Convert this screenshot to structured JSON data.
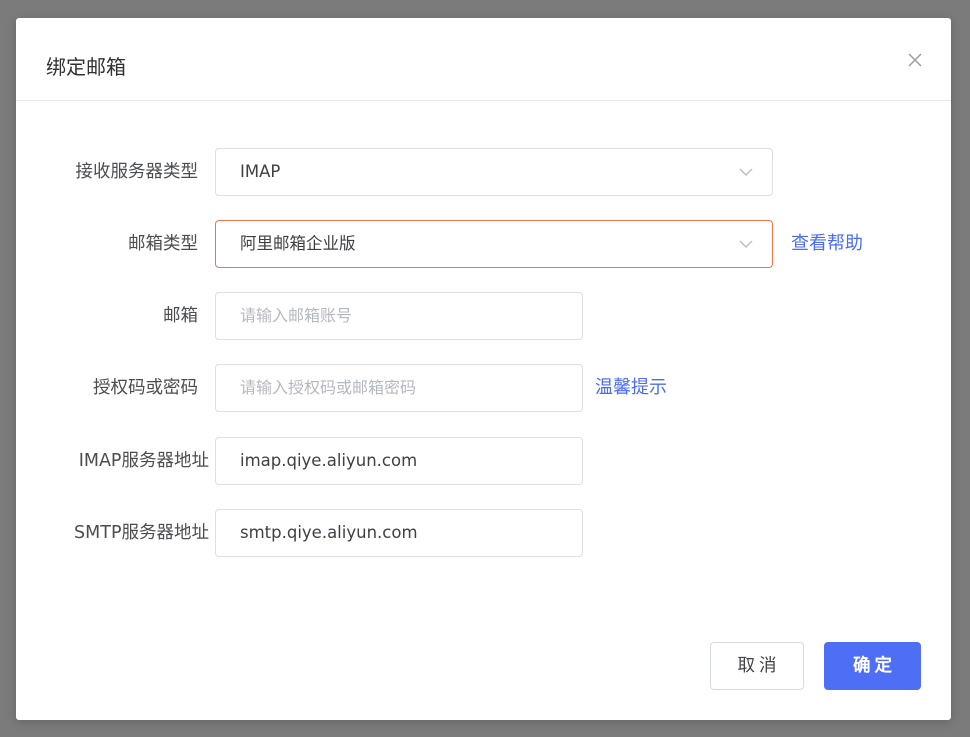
{
  "dialog": {
    "title": "绑定邮箱"
  },
  "form": {
    "receive_server_type": {
      "label": "接收服务器类型",
      "value": "IMAP"
    },
    "mailbox_type": {
      "label": "邮箱类型",
      "value": "阿里邮箱企业版",
      "help_link": "查看帮助"
    },
    "email": {
      "label": "邮箱",
      "placeholder": "请输入邮箱账号"
    },
    "auth_code": {
      "label": "授权码或密码",
      "placeholder": "请输入授权码或邮箱密码",
      "tip_link": "温馨提示"
    },
    "imap_server": {
      "label": "IMAP服务器地址",
      "value": "imap.qiye.aliyun.com"
    },
    "smtp_server": {
      "label": "SMTP服务器地址",
      "value": "smtp.qiye.aliyun.com"
    }
  },
  "footer": {
    "cancel_label": "取消",
    "confirm_label": "确定"
  },
  "colors": {
    "primary": "#4d6ef5",
    "link": "#4a6cf7",
    "active_border": "#f0744a"
  },
  "icons": {
    "close": "close-icon",
    "dropdown": "chevron-down-icon"
  }
}
